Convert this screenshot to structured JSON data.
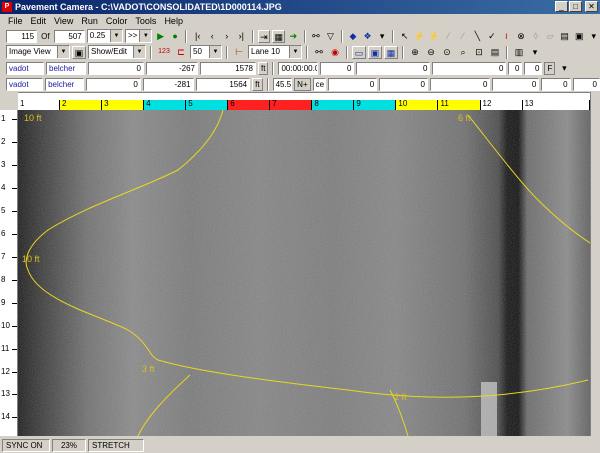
{
  "window": {
    "title": "Pavement Camera - C:\\VADOT\\CONSOLIDATED\\1D000114.JPG",
    "icon_label": "P",
    "minimize": "_",
    "maximize": "□",
    "close": "✕"
  },
  "menu": [
    {
      "label": "File"
    },
    {
      "label": "Edit"
    },
    {
      "label": "View"
    },
    {
      "label": "Run"
    },
    {
      "label": "Color"
    },
    {
      "label": "Tools"
    },
    {
      "label": "Help"
    }
  ],
  "toolbar1": {
    "frame": "115",
    "frame_unit": "Of",
    "total": "507",
    "speed": "0.25",
    "fast_forward": ">>"
  },
  "toolbar2": {
    "view_mode": "Image View",
    "show_edit": "Show/Edit",
    "scale_label": "123",
    "scale_value": "50",
    "lane": "Lane 10"
  },
  "row3": {
    "district": "vadot",
    "name": "belcher",
    "v1": "0",
    "v2": "-267",
    "v3": "1578",
    "v3_unit": "ft",
    "time": "00:00:00.0",
    "t1": "0",
    "t2": "0",
    "t3": "0",
    "t4": "0",
    "t5": "0",
    "flag": "F"
  },
  "row4": {
    "district": "vadot",
    "name": "belcher",
    "v1": "0",
    "v2": "-281",
    "v3": "1564",
    "v3_unit": "ft",
    "lat": "45.5",
    "lat_dir": "N+",
    "lat_unit": "ce",
    "t1": "0",
    "t2": "0",
    "t3": "0",
    "t4": "0",
    "t5": "0",
    "t6": "0"
  },
  "top_ruler": [
    {
      "label": "1",
      "color": "#ffffff"
    },
    {
      "label": "2",
      "color": "#ffff00"
    },
    {
      "label": "3",
      "color": "#ffff00"
    },
    {
      "label": "4",
      "color": "#00e0e0"
    },
    {
      "label": "5",
      "color": "#00e0e0"
    },
    {
      "label": "6",
      "color": "#ff2020"
    },
    {
      "label": "7",
      "color": "#ff2020"
    },
    {
      "label": "8",
      "color": "#00e0e0"
    },
    {
      "label": "9",
      "color": "#00e0e0"
    },
    {
      "label": "10",
      "color": "#ffff00"
    },
    {
      "label": "11",
      "color": "#ffff00"
    },
    {
      "label": "12",
      "color": "#ffffff"
    },
    {
      "label": "13",
      "color": "#ffffff"
    }
  ],
  "left_ruler": [
    "1",
    "2",
    "3",
    "4",
    "5",
    "6",
    "7",
    "8",
    "9",
    "10",
    "11",
    "12",
    "13",
    "14"
  ],
  "overlay_labels": {
    "a": "10 ft",
    "b": "6 ft",
    "c": "10 ft",
    "d": "3 ft",
    "e": "2 ft"
  },
  "status": {
    "sync": "SYNC ON",
    "zoom": "23%",
    "mode": "STRETCH"
  },
  "colors": {
    "crack_line": "#e8d820",
    "label_text": "#d8c020"
  }
}
